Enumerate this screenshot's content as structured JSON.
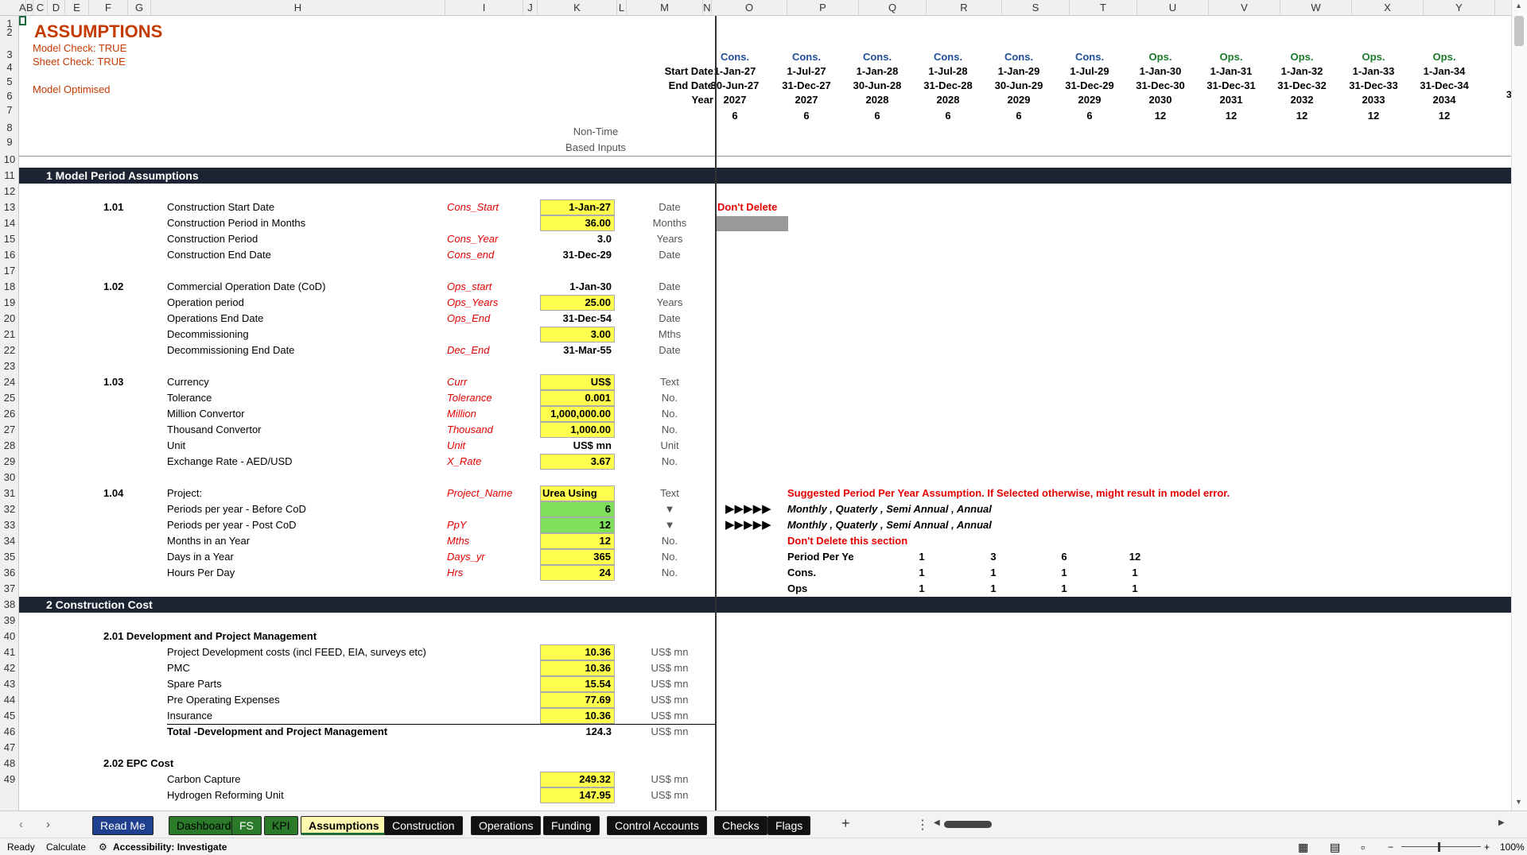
{
  "columns": [
    "A",
    "B",
    "C",
    "D",
    "E",
    "F",
    "G",
    "H",
    "I",
    "J",
    "K",
    "L",
    "M",
    "N",
    "O",
    "P",
    "Q",
    "R",
    "S",
    "T",
    "U",
    "V",
    "W",
    "X",
    "Y"
  ],
  "rows": [
    "1",
    "2",
    "3",
    "4",
    "5",
    "6",
    "7",
    "8",
    "9",
    "10",
    "11",
    "12",
    "13",
    "14",
    "15",
    "16",
    "17",
    "18",
    "19",
    "20",
    "21",
    "22",
    "23",
    "24",
    "25",
    "26",
    "27",
    "28",
    "29",
    "30",
    "31",
    "32",
    "33",
    "34",
    "35",
    "36",
    "37",
    "38",
    "39",
    "40",
    "41",
    "42",
    "43",
    "44",
    "45",
    "46",
    "47",
    "48",
    "49"
  ],
  "header": {
    "title": "ASSUMPTIONS",
    "model_check": "Model Check: TRUE",
    "sheet_check": "Sheet Check: TRUE",
    "model_optimised": "Model Optimised",
    "start_label": "Start Date",
    "end_label": "End Date",
    "year_label": "Year",
    "non_time_1": "Non-Time",
    "non_time_2": "Based Inputs"
  },
  "timeline": [
    {
      "phase": "Cons.",
      "start": "1-Jan-27",
      "end": "30-Jun-27",
      "year": "2027",
      "months": "6"
    },
    {
      "phase": "Cons.",
      "start": "1-Jul-27",
      "end": "31-Dec-27",
      "year": "2027",
      "months": "6"
    },
    {
      "phase": "Cons.",
      "start": "1-Jan-28",
      "end": "30-Jun-28",
      "year": "2028",
      "months": "6"
    },
    {
      "phase": "Cons.",
      "start": "1-Jul-28",
      "end": "31-Dec-28",
      "year": "2028",
      "months": "6"
    },
    {
      "phase": "Cons.",
      "start": "1-Jan-29",
      "end": "30-Jun-29",
      "year": "2029",
      "months": "6"
    },
    {
      "phase": "Cons.",
      "start": "1-Jul-29",
      "end": "31-Dec-29",
      "year": "2029",
      "months": "6"
    },
    {
      "phase": "Ops.",
      "start": "1-Jan-30",
      "end": "31-Dec-30",
      "year": "2030",
      "months": "12"
    },
    {
      "phase": "Ops.",
      "start": "1-Jan-31",
      "end": "31-Dec-31",
      "year": "2031",
      "months": "12"
    },
    {
      "phase": "Ops.",
      "start": "1-Jan-32",
      "end": "31-Dec-32",
      "year": "2032",
      "months": "12"
    },
    {
      "phase": "Ops.",
      "start": "1-Jan-33",
      "end": "31-Dec-33",
      "year": "2033",
      "months": "12"
    },
    {
      "phase": "Ops.",
      "start": "1-Jan-34",
      "end": "31-Dec-34",
      "year": "2034",
      "months": "12"
    }
  ],
  "overflow_char": "3",
  "sections": {
    "s1": "1  Model Period Assumptions",
    "s2": "2  Construction Cost"
  },
  "items": [
    {
      "num": "1.01",
      "label": "Construction Start Date",
      "name": "Cons_Start",
      "value": "1-Jan-27",
      "unit": "Date",
      "input": true
    },
    {
      "num": "",
      "label": "Construction Period in Months",
      "name": "",
      "value": "36.00",
      "unit": "Months",
      "input": true
    },
    {
      "num": "",
      "label": "Construction Period",
      "name": "Cons_Year",
      "value": "3.0",
      "unit": "Years",
      "input": false
    },
    {
      "num": "",
      "label": "Construction End Date",
      "name": "Cons_end",
      "value": "31-Dec-29",
      "unit": "Date",
      "input": false
    },
    {
      "num": "1.02",
      "label": "Commercial Operation Date (CoD)",
      "name": "Ops_start",
      "value": "1-Jan-30",
      "unit": "Date",
      "input": false
    },
    {
      "num": "",
      "label": "Operation period",
      "name": "Ops_Years",
      "value": "25.00",
      "unit": "Years",
      "input": true
    },
    {
      "num": "",
      "label": "Operations End Date",
      "name": "Ops_End",
      "value": "31-Dec-54",
      "unit": "Date",
      "input": false
    },
    {
      "num": "",
      "label": "Decommissioning",
      "name": "",
      "value": "3.00",
      "unit": "Mths",
      "input": true
    },
    {
      "num": "",
      "label": "Decommissioning End Date",
      "name": "Dec_End",
      "value": "31-Mar-55",
      "unit": "Date",
      "input": false
    },
    {
      "num": "1.03",
      "label": "Currency",
      "name": "Curr",
      "value": "US$",
      "unit": "Text",
      "input": true
    },
    {
      "num": "",
      "label": "Tolerance",
      "name": "Tolerance",
      "value": "0.001",
      "unit": "No.",
      "input": true
    },
    {
      "num": "",
      "label": "Million Convertor",
      "name": "Million",
      "value": "1,000,000.00",
      "unit": "No.",
      "input": true
    },
    {
      "num": "",
      "label": "Thousand Convertor",
      "name": "Thousand",
      "value": "1,000.00",
      "unit": "No.",
      "input": true
    },
    {
      "num": "",
      "label": "Unit",
      "name": "Unit",
      "value": "US$ mn",
      "unit": "Unit",
      "input": false
    },
    {
      "num": "",
      "label": "Exchange Rate - AED/USD",
      "name": "X_Rate",
      "value": "3.67",
      "unit": "No.",
      "input": true
    },
    {
      "num": "1.04",
      "label": "Project:",
      "name": "Project_Name",
      "value": "Urea Using Natur",
      "unit": "Text",
      "input": true
    },
    {
      "num": "",
      "label": "Periods per year - Before CoD",
      "name": "",
      "value": "6",
      "unit": "▼",
      "input": "green"
    },
    {
      "num": "",
      "label": "Periods per year - Post CoD",
      "name": "PpY",
      "value": "12",
      "unit": "▼",
      "input": "green"
    },
    {
      "num": "",
      "label": "Months in an Year",
      "name": "Mths",
      "value": "12",
      "unit": "No.",
      "input": true
    },
    {
      "num": "",
      "label": "Days in a Year",
      "name": "Days_yr",
      "value": "365",
      "unit": "No.",
      "input": true
    },
    {
      "num": "",
      "label": "Hours Per Day",
      "name": "Hrs",
      "value": "24",
      "unit": "No.",
      "input": true
    }
  ],
  "side": {
    "dont_delete": "Don't Delete",
    "suggested": "Suggested Period Per Year Assumption. If Selected otherwise, might result in model error.",
    "arrows": "▶▶▶▶▶",
    "options": "Monthly ,  Quaterly ,  Semi Annual ,  Annual",
    "dont_delete_section": "Don't Delete this section",
    "ppy_label": "Period Per Ye",
    "cons_label": "Cons.",
    "ops_label": "Ops",
    "ppy": [
      "1",
      "3",
      "6",
      "12"
    ],
    "cons": [
      "1",
      "1",
      "1",
      "1"
    ],
    "ops": [
      "1",
      "1",
      "1",
      "1"
    ]
  },
  "cost": {
    "h1": "2.01  Development and Project Management",
    "r1": [
      {
        "label": "Project Development costs (incl FEED, EIA, surveys etc)",
        "value": "10.36",
        "unit": "US$ mn"
      },
      {
        "label": "PMC",
        "value": "10.36",
        "unit": "US$ mn"
      },
      {
        "label": "Spare Parts",
        "value": "15.54",
        "unit": "US$ mn"
      },
      {
        "label": "Pre Operating Expenses",
        "value": "77.69",
        "unit": "US$ mn"
      },
      {
        "label": "Insurance",
        "value": "10.36",
        "unit": "US$ mn"
      }
    ],
    "total_label": "Total -Development and Project Management",
    "total_value": "124.3",
    "total_unit": "US$ mn",
    "h2": "2.02  EPC Cost",
    "r2": [
      {
        "label": "Carbon Capture",
        "value": "249.32",
        "unit": "US$ mn"
      },
      {
        "label": "Hydrogen Reforming Unit",
        "value": "147.95",
        "unit": "US$ mn"
      }
    ]
  },
  "tabs": [
    "Read Me",
    "Dashboard",
    "FS",
    "KPI",
    "Assumptions",
    "Construction",
    "Operations",
    "Funding",
    "Control Accounts",
    "Checks",
    "Flags"
  ],
  "tab_add": "+",
  "status": {
    "ready": "Ready",
    "calculate": "Calculate",
    "accessibility": "Accessibility: Investigate",
    "zoom": "100%"
  }
}
